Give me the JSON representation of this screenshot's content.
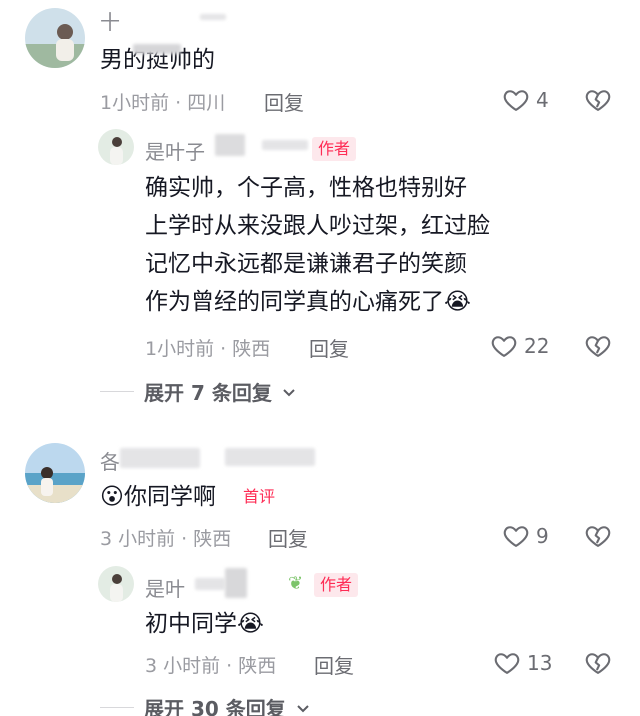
{
  "comment1": {
    "name": "十",
    "text": "男的挺帅的",
    "meta": "1小时前 · 四川",
    "reply_label": "回复",
    "likes": "4",
    "reply": {
      "name": "是叶子",
      "author_tag": "作者",
      "lines": [
        "确实帅，个子高，性格也特别好",
        "上学时从来没跟人吵过架，红过脸",
        "记忆中永远都是谦谦君子的笑颜",
        "作为曾经的同学真的心痛死了"
      ],
      "emoji": "😭",
      "meta": "1小时前 · 陕西",
      "reply_label": "回复",
      "likes": "22"
    },
    "expand_label": "展开 7 条回复"
  },
  "comment2": {
    "name": "各",
    "emoji": "😮",
    "text": "你同学啊",
    "first_tag": "首评",
    "meta": "3 小时前 · 陕西",
    "reply_label": "回复",
    "likes": "9",
    "reply": {
      "name": "是叶",
      "author_tag": "作者",
      "text": "初中同学",
      "emoji": "😭",
      "meta": "3 小时前 · 陕西",
      "reply_label": "回复",
      "likes": "13"
    },
    "expand_label": "展开 30 条回复"
  },
  "colors": {
    "accent": "#fe2c55",
    "meta_gray": "#9a9ba1",
    "text": "#161823"
  },
  "icons": [
    "heart-icon",
    "broken-heart-icon",
    "chevron-down-icon"
  ]
}
